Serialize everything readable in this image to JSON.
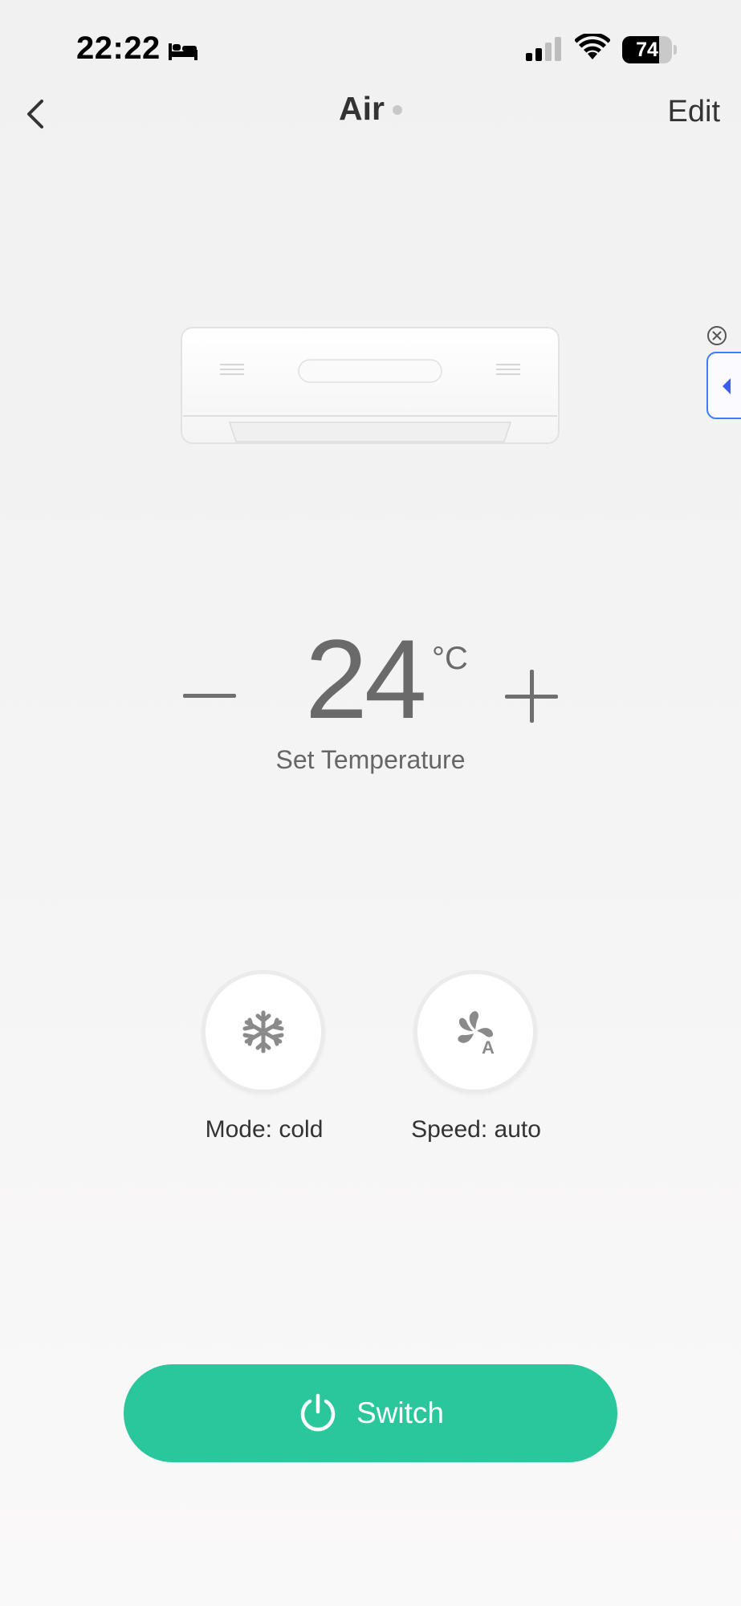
{
  "status_bar": {
    "time": "22:22",
    "battery_level": "74",
    "battery_fraction": 0.74,
    "icons": [
      "bed-icon",
      "cellular-signal-icon",
      "wifi-icon",
      "battery-icon"
    ]
  },
  "nav": {
    "back_icon": "chevron-left-icon",
    "title": "Air",
    "edit_label": "Edit"
  },
  "device": {
    "image": "air-conditioner-unit"
  },
  "floating_tab": {
    "close_icon": "close-circle-icon",
    "expand_icon": "triangle-left-icon",
    "accent_color": "#3d7bff"
  },
  "temperature": {
    "value": "24",
    "unit": "°C",
    "label": "Set Temperature",
    "decrease_icon": "minus-icon",
    "increase_icon": "plus-icon"
  },
  "controls": {
    "mode": {
      "label": "Mode: cold",
      "icon": "snowflake-icon"
    },
    "speed": {
      "label": "Speed: auto",
      "icon": "fan-auto-icon"
    }
  },
  "power": {
    "label": "Switch",
    "icon": "power-icon",
    "color": "#29c79b"
  }
}
